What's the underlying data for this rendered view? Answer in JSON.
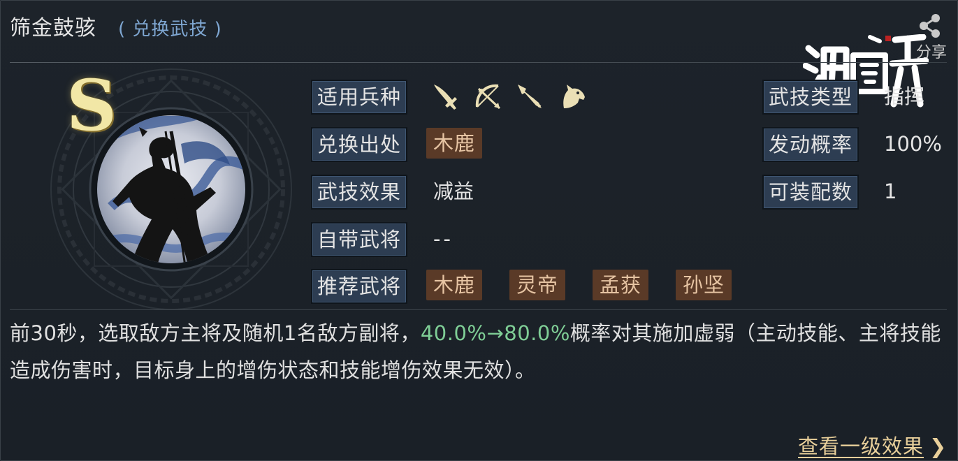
{
  "header": {
    "title": "筛金鼓骇",
    "subtitle": "( 兑换武技 )",
    "share_label": "分享"
  },
  "portrait": {
    "grade": "S",
    "icon": "warrior-silhouette-portrait"
  },
  "attributes_left": {
    "troop_types": {
      "label": "适用兵种",
      "icons": [
        "sword-infantry-icon",
        "bow-archer-icon",
        "spear-icon",
        "horse-cavalry-icon"
      ]
    },
    "source": {
      "label": "兑换出处",
      "value": "木鹿"
    },
    "effect": {
      "label": "武技效果",
      "value": "减益"
    },
    "own_general": {
      "label": "自带武将",
      "value": "--"
    },
    "recommended": {
      "label": "推荐武将",
      "values": [
        "木鹿",
        "灵帝",
        "孟获",
        "孙坚"
      ]
    }
  },
  "attributes_right": {
    "type": {
      "label": "武技类型",
      "value": "指挥"
    },
    "trigger_rate": {
      "label": "发动概率",
      "value": "100%"
    },
    "equip_count": {
      "label": "可装配数",
      "value": "1"
    }
  },
  "description": {
    "part1": "前30秒，选取敌方主将及随机1名敌方副将，",
    "highlight": "40.0%→80.0%",
    "part2": "概率对其施加虚弱（主动技能、主将技能造成伤害时，目标身上的增伤状态和技能增伤效果无效）。"
  },
  "footer": {
    "link_label": "查看一级效果",
    "arrow": "❯"
  },
  "colors": {
    "chip_bg": "#5a3a27",
    "chip_text": "#e6c4a3",
    "key_bg": "#2d3d52",
    "highlight": "#7fce96",
    "link": "#e8cf9a",
    "subtitle": "#7fa7d2",
    "grade": "#f2e7a6"
  }
}
